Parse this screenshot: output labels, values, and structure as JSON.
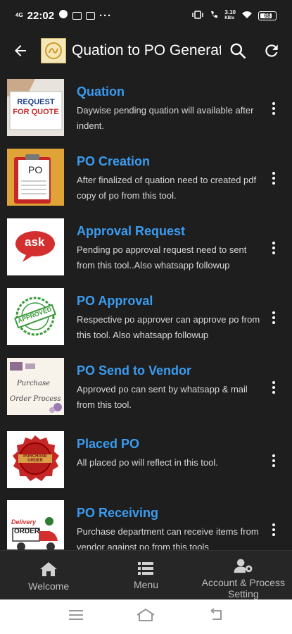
{
  "status_bar": {
    "network": "4G",
    "time": "22:02",
    "speed": "3.10",
    "speed_unit": "KB/s",
    "battery": "68"
  },
  "app_bar": {
    "title": "Quation to PO Generat"
  },
  "items": [
    {
      "title": "Quation",
      "desc": "Daywise pending quation will available after indent.",
      "thumb_text": [
        "REQUEST",
        "FOR QUOTE"
      ]
    },
    {
      "title": "PO Creation",
      "desc": "After finalized of quation need to created pdf copy of po from this tool.",
      "thumb_text": [
        "PO"
      ]
    },
    {
      "title": "Approval Request",
      "desc": "Pending po approval request need to sent from this tool..Also whatsapp followup",
      "thumb_text": [
        "ask"
      ]
    },
    {
      "title": "PO Approval",
      "desc": "Respective po approver can approve po from this tool. Also whatsapp followup",
      "thumb_text": [
        "APPROVED"
      ]
    },
    {
      "title": "PO Send to Vendor",
      "desc": "Approved po can sent by whatsapp & mail from this tool.",
      "thumb_text": [
        "Purchase",
        "Order Process"
      ]
    },
    {
      "title": "Placed PO",
      "desc": "All placed po will reflect in this tool.",
      "thumb_text": [
        "PURCHASE",
        "ORDER"
      ]
    },
    {
      "title": "PO Receiving",
      "desc": "Purchase department can receive items from vendor against po from this tools",
      "thumb_text": [
        "Delivery",
        "ORDER"
      ]
    }
  ],
  "bottom_nav": {
    "welcome": "Welcome",
    "menu": "Menu",
    "account": "Account & Process Setting"
  },
  "colors": {
    "background": "#1e1e1e",
    "title_blue": "#3b9cf0",
    "bottom_nav": "#262626"
  }
}
